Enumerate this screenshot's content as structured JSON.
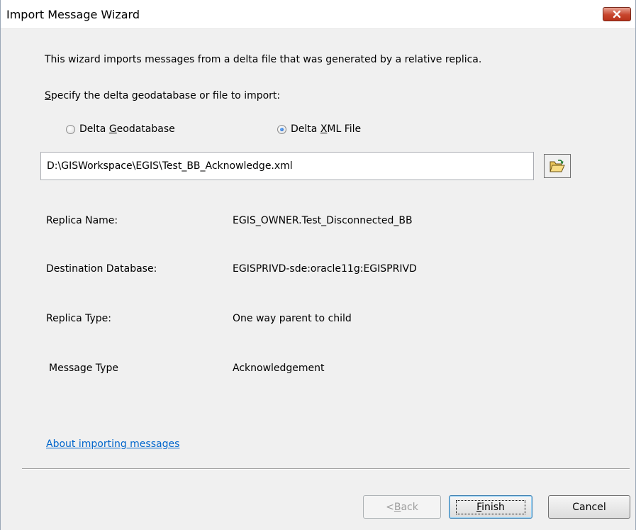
{
  "window": {
    "title": "Import Message Wizard"
  },
  "intro_text": "This wizard imports messages from a delta file that was generated by a relative replica.",
  "specify_label": {
    "mnemonic": "S",
    "rest": "pecify the delta geodatabase or file to import:"
  },
  "options": [
    {
      "pre": "Delta ",
      "mnemonic": "G",
      "post": "eodatabase",
      "selected": false
    },
    {
      "pre": "Delta ",
      "mnemonic": "X",
      "post": "ML File",
      "selected": true
    }
  ],
  "file_path": "D:\\GISWorkspace\\EGIS\\Test_BB_Acknowledge.xml",
  "details": [
    {
      "label": "Replica Name:",
      "value": "EGIS_OWNER.Test_Disconnected_BB"
    },
    {
      "label": "Destination Database:",
      "value": "EGISPRIVD-sde:oracle11g:EGISPRIVD"
    },
    {
      "label": "Replica Type:",
      "value": "One way parent to child"
    },
    {
      "label": "Message Type",
      "value": "Acknowledgement"
    }
  ],
  "help_link": "About importing messages",
  "buttons": {
    "back": {
      "pre": "< ",
      "mnemonic": "B",
      "post": "ack"
    },
    "finish": {
      "mnemonic": "F",
      "post": "inish"
    },
    "cancel": "Cancel"
  },
  "icons": {
    "close": "close-icon",
    "browse": "open-folder-icon"
  },
  "colors": {
    "link": "#0066cc",
    "close_button": "#c8452c",
    "window_bg": "#f0f0f0"
  }
}
